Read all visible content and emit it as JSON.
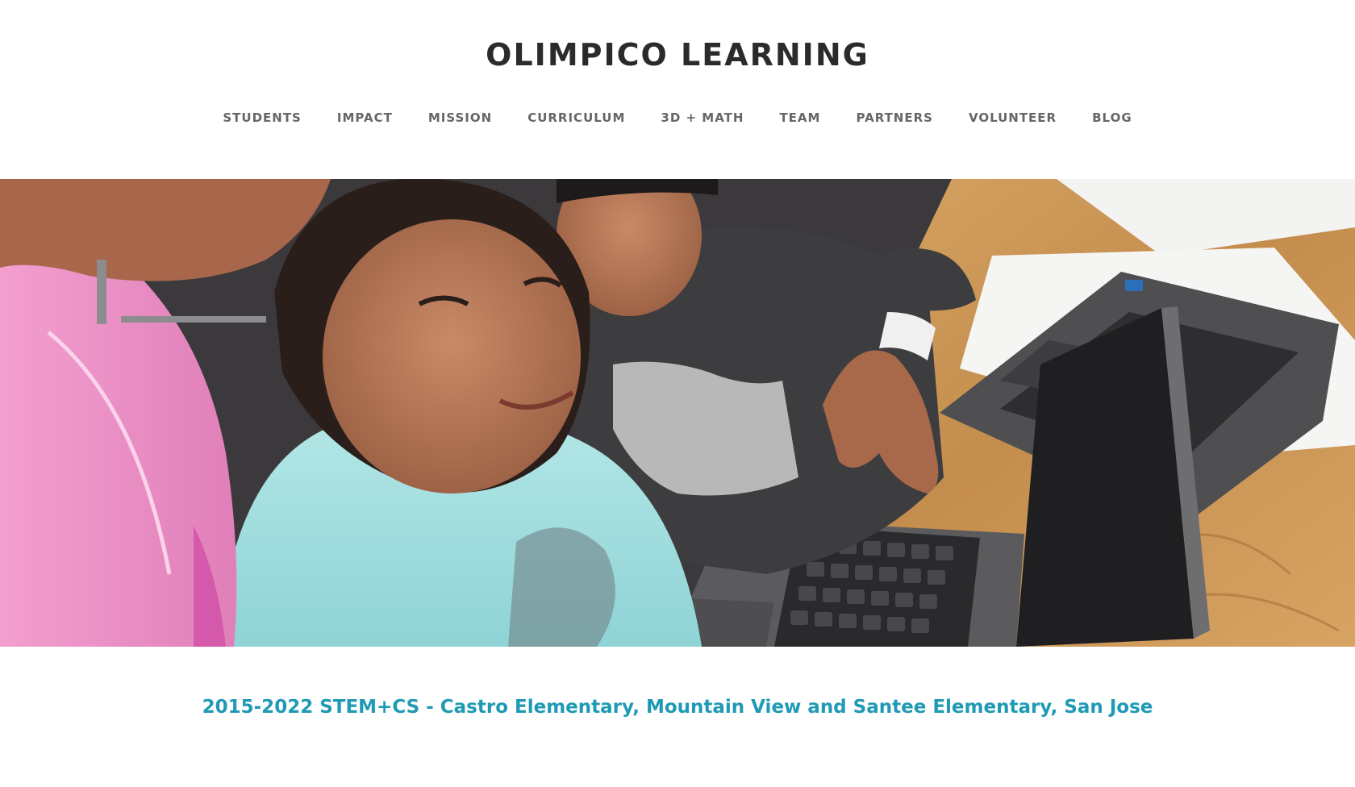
{
  "header": {
    "site_title": "OLIMPICO LEARNING"
  },
  "nav": {
    "items": [
      {
        "label": "STUDENTS"
      },
      {
        "label": "IMPACT"
      },
      {
        "label": "MISSION"
      },
      {
        "label": "CURRICULUM"
      },
      {
        "label": "3D + MATH"
      },
      {
        "label": "TEAM"
      },
      {
        "label": "PARTNERS"
      },
      {
        "label": "VOLUNTEER"
      },
      {
        "label": "BLOG"
      }
    ]
  },
  "hero": {
    "image_subject": "students-with-laptops-photo",
    "colors": {
      "pink_hoodie": "#ec8fc6",
      "aqua_hoodie": "#9fdcdf",
      "dark_sweater": "#3c3c3e",
      "table_wood": "#c99555",
      "laptop_gray": "#5c5c5e"
    }
  },
  "content": {
    "caption": "2015-2022 STEM+CS - Castro Elementary, Mountain View and Santee Elementary, San Jose"
  },
  "colors": {
    "title": "#2b2b2b",
    "nav": "#666666",
    "caption_accent": "#1f9ab5",
    "background": "#ffffff"
  }
}
